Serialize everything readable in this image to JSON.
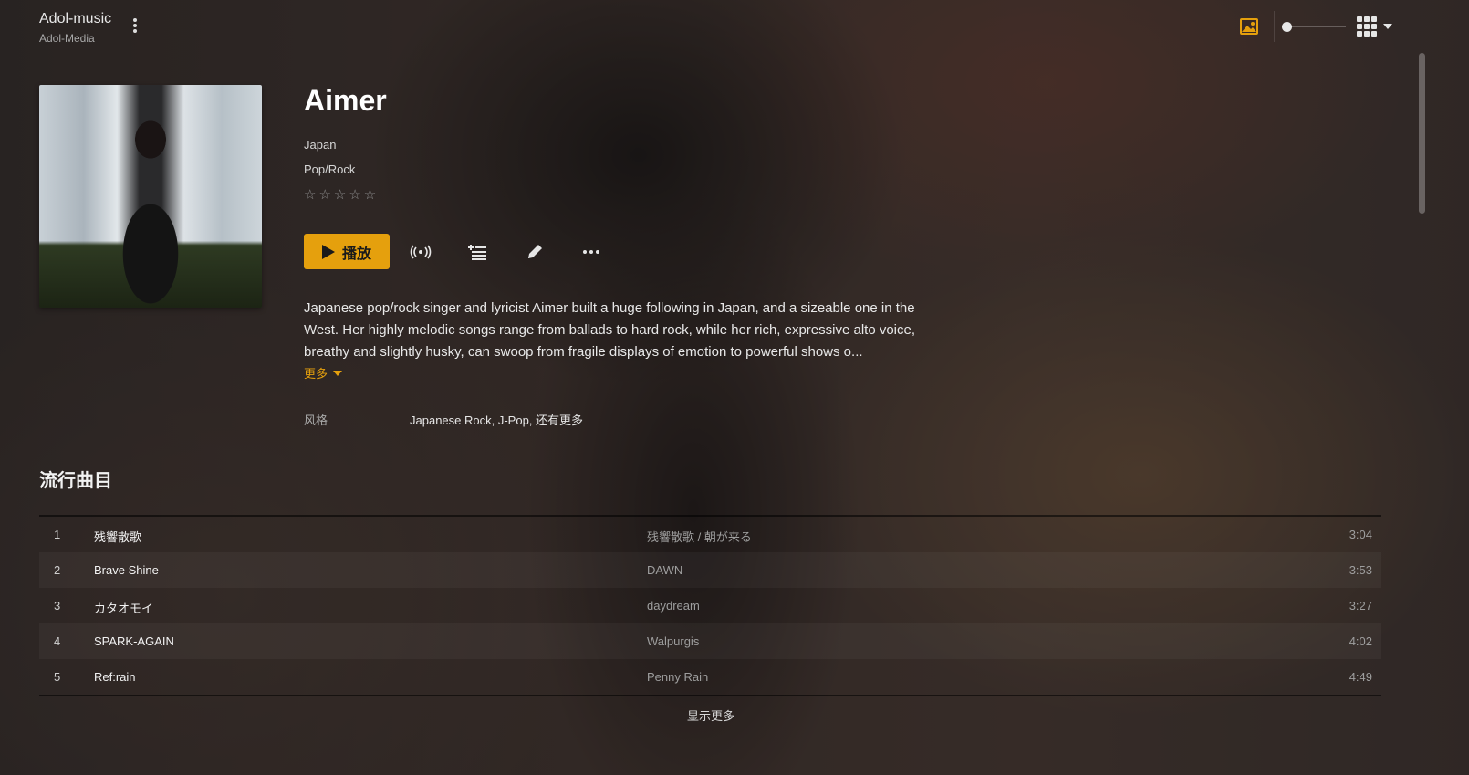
{
  "header": {
    "app_title": "Adol-music",
    "app_subtitle": "Adol-Media"
  },
  "artist": {
    "name": "Aimer",
    "country": "Japan",
    "genre": "Pop/Rock",
    "rating": {
      "value": 0,
      "max": 5
    },
    "stars": "☆☆☆☆☆",
    "play_label": "播放",
    "bio": "Japanese pop/rock singer and lyricist Aimer built a huge following in Japan, and a sizeable one in the West. Her highly melodic songs range from ballads to hard rock, while her rich, expressive alto voice, breathy and slightly husky, can swoop from fragile displays of emotion to powerful shows o...",
    "more_label": "更多",
    "style_label": "风格",
    "style_value": "Japanese Rock, J-Pop, 还有更多"
  },
  "popular": {
    "title": "流行曲目",
    "tracks": [
      {
        "num": "1",
        "title": "残響散歌",
        "album": "残響散歌 / 朝が来る",
        "duration": "3:04"
      },
      {
        "num": "2",
        "title": "Brave Shine",
        "album": "DAWN",
        "duration": "3:53"
      },
      {
        "num": "3",
        "title": "カタオモイ",
        "album": "daydream",
        "duration": "3:27"
      },
      {
        "num": "4",
        "title": "SPARK-AGAIN",
        "album": "Walpurgis",
        "duration": "4:02"
      },
      {
        "num": "5",
        "title": "Ref:rain",
        "album": "Penny Rain",
        "duration": "4:49"
      }
    ],
    "show_more": "显示更多"
  },
  "controls": {
    "zoom_level": 0
  },
  "colors": {
    "accent": "#e5a00d"
  },
  "icons": [
    "more-vertical-icon",
    "image-icon",
    "grid-view-icon",
    "chevron-down-icon",
    "play-icon",
    "radio-icon",
    "add-to-queue-icon",
    "edit-pencil-icon",
    "more-horizontal-icon",
    "star-icon"
  ]
}
